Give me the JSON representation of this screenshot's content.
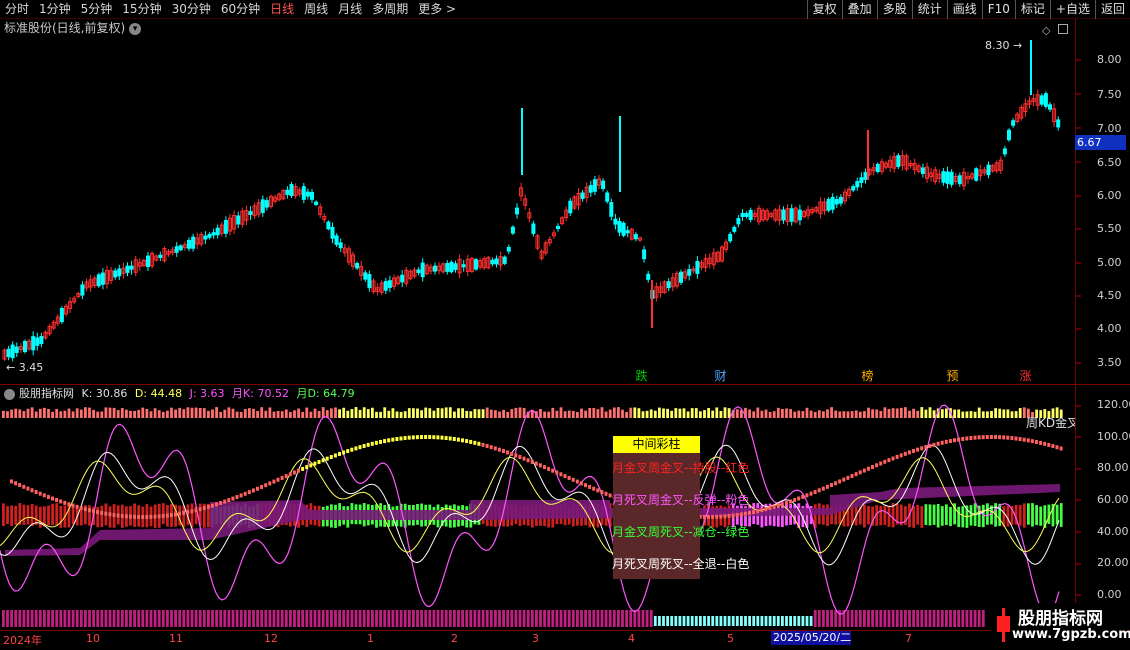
{
  "toolbar": {
    "periods": [
      "分时",
      "1分钟",
      "5分钟",
      "15分钟",
      "30分钟",
      "60分钟",
      "日线",
      "周线",
      "月线",
      "多周期",
      "更多 >"
    ],
    "active_period": "日线",
    "buttons": [
      "复权",
      "叠加",
      "多股",
      "统计",
      "画线",
      "F10",
      "标记",
      "+自选",
      "返回"
    ]
  },
  "price_panel": {
    "title": "标准股份(日线,前复权)",
    "dropdown_icon": "chevron-down-icon",
    "settings_icons": [
      "diamond-icon",
      "square-icon"
    ],
    "y_labels": [
      "8.00",
      "7.50",
      "7.00",
      "6.50",
      "6.00",
      "5.50",
      "5.00",
      "4.50",
      "4.00",
      "3.50"
    ],
    "current_price": "6.67",
    "high_annotation": "8.30",
    "low_annotation": "3.45",
    "event_markers": [
      {
        "label": "跌",
        "color": "#00cc00"
      },
      {
        "label": "财",
        "color": "#4da6ff"
      },
      {
        "label": "榜",
        "color": "#ffb000"
      },
      {
        "label": "预",
        "color": "#ffb000"
      },
      {
        "label": "涨",
        "color": "#ff3333"
      }
    ],
    "up_color": "#ff3030",
    "down_color": "#00ffff"
  },
  "indicator_panel": {
    "name": "股朋指标网",
    "values": [
      {
        "label": "K: 30.86",
        "color": "#e0e0e0"
      },
      {
        "label": "D: 44.48",
        "color": "#ffff55"
      },
      {
        "label": "J: 3.63",
        "color": "#ff55ff"
      },
      {
        "label": "月K: 70.52",
        "color": "#ff55ff"
      },
      {
        "label": "月D: 64.79",
        "color": "#55ff55"
      }
    ],
    "y_labels": [
      "120.00",
      "100.00",
      "80.00",
      "60.00",
      "40.00",
      "20.00",
      "0.00"
    ],
    "side_text": "周KD金叉",
    "legend": {
      "title": "中间彩柱",
      "items": [
        {
          "text": "月金叉周金叉--持股--红色",
          "color": "#ff2020"
        },
        {
          "text": "月死叉周金叉--反弹--粉色",
          "color": "#ff55ff"
        },
        {
          "text": "月金叉周死叉--减仓--绿色",
          "color": "#33ff33"
        },
        {
          "text": "月死叉周死叉--全退--白色",
          "color": "#ffffff"
        }
      ]
    }
  },
  "timeline": {
    "labels": [
      "2024年",
      "10",
      "11",
      "12",
      "1",
      "2",
      "3",
      "4",
      "5",
      "2025/05/20/二",
      "7"
    ],
    "highlighted": "2025/05/20/二"
  },
  "watermark": {
    "name": "股朋指标网",
    "url": "www.7gpzb.com"
  }
}
